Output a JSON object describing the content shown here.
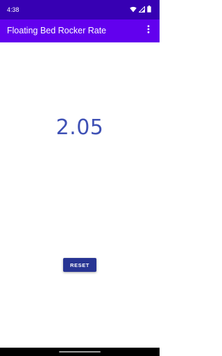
{
  "status_bar": {
    "time": "4:38",
    "icons": [
      "wifi-icon",
      "signal-icon",
      "battery-icon"
    ]
  },
  "app_bar": {
    "title": "Floating Bed Rocker Rate",
    "menu_icon": "overflow-menu-icon"
  },
  "main": {
    "rate_value": "2.05",
    "reset_label": "RESET"
  },
  "colors": {
    "status_bar": "#3700b3",
    "app_bar": "#6200ee",
    "rate_text": "#3f51b5",
    "button": "#283593",
    "background": "#ffffff",
    "nav_bar": "#000000"
  }
}
